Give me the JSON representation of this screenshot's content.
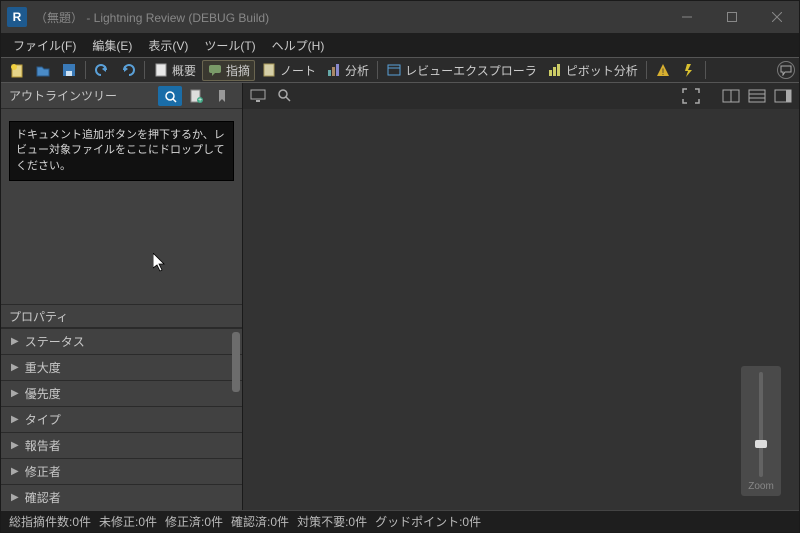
{
  "window": {
    "appicon_letter": "R",
    "title": "（無題） - Lightning Review (DEBUG Build)"
  },
  "menu": {
    "file": "ファイル(F)",
    "edit": "編集(E)",
    "view": "表示(V)",
    "tool": "ツール(T)",
    "help": "ヘルプ(H)"
  },
  "toolbar": {
    "overview": "概要",
    "pointout": "指摘",
    "note": "ノート",
    "analysis": "分析",
    "review_explorer": "レビューエクスプローラ",
    "pivot_analysis": "ピボット分析"
  },
  "left": {
    "outline_title": "アウトラインツリー",
    "drop_message": "ドキュメント追加ボタンを押下するか、レビュー対象ファイルをここにドロップしてください。",
    "properties_title": "プロパティ",
    "props": [
      {
        "label": "ステータス"
      },
      {
        "label": "重大度"
      },
      {
        "label": "優先度"
      },
      {
        "label": "タイプ"
      },
      {
        "label": "報告者"
      },
      {
        "label": "修正者"
      },
      {
        "label": "確認者"
      }
    ]
  },
  "zoom": {
    "label": "Zoom"
  },
  "status": {
    "s1": "総指摘件数:0件",
    "s2": "未修正:0件",
    "s3": "修正済:0件",
    "s4": "確認済:0件",
    "s5": "対策不要:0件",
    "s6": "グッドポイント:0件"
  }
}
